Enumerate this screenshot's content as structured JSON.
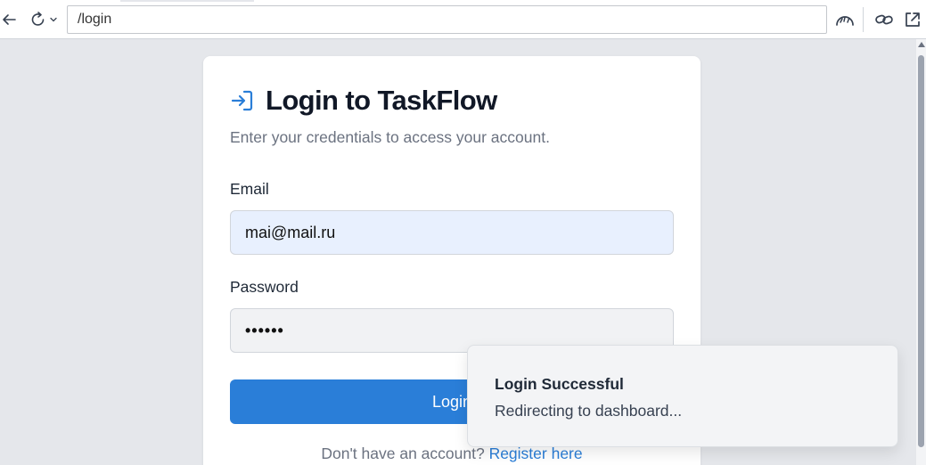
{
  "browser": {
    "address": "/login"
  },
  "card": {
    "title": "Login to TaskFlow",
    "subtitle": "Enter your credentials to access your account.",
    "email_label": "Email",
    "email_value": "mai@mail.ru",
    "password_label": "Password",
    "password_value": "••••••",
    "login_button": "Login",
    "register_prompt": "Don't have an account?",
    "register_link": "Register here"
  },
  "toast": {
    "title": "Login Successful",
    "description": "Redirecting to dashboard..."
  },
  "icons": {
    "back": "back-arrow-icon",
    "reload": "reload-icon",
    "dropdown": "chevron-down-icon",
    "speed": "speedometer-icon",
    "link": "link-icon",
    "external": "open-external-icon",
    "login": "login-icon"
  },
  "colors": {
    "accent": "#2a7ed8",
    "background": "#e5e7eb",
    "email_autofill": "#e8f0fe"
  }
}
